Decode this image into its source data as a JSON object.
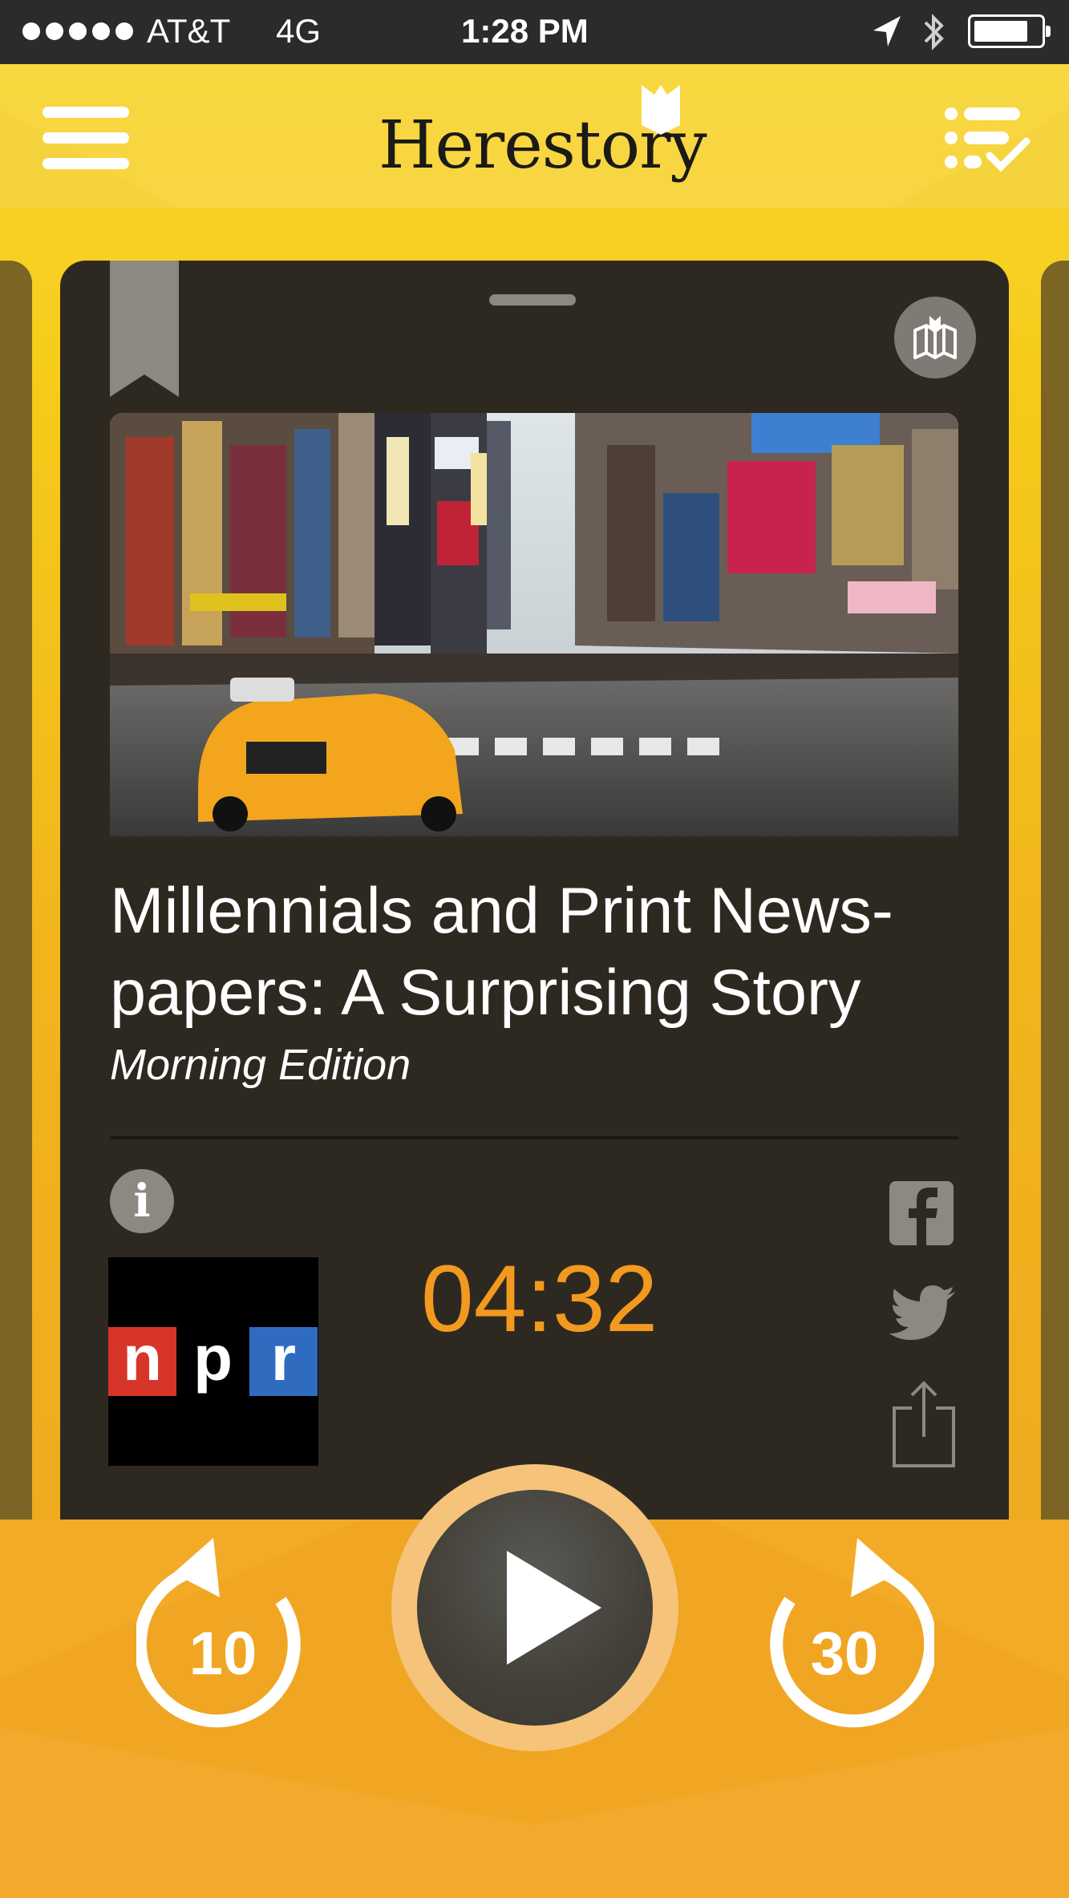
{
  "status_bar": {
    "carrier": "AT&T",
    "network": "4G",
    "time": "1:28 PM"
  },
  "header": {
    "title": "Herestory"
  },
  "story": {
    "title": "Millennials and Print News-papers: A Surprising Story",
    "title_line1": "Millennials and Print News-",
    "title_line2": "papers: A Surprising Story",
    "program": "Morning Edition",
    "duration": "04:32",
    "source_logo": {
      "n": "n",
      "p": "p",
      "r": "r"
    }
  },
  "controls": {
    "rewind_seconds": "10",
    "forward_seconds": "30"
  },
  "colors": {
    "accent": "#f29a1f",
    "header_yellow": "#f7d83e",
    "card_bg": "#2e2920",
    "controls_bg": "#f0a623"
  },
  "icons": [
    "menu-icon",
    "bookmark-icon",
    "playlist-check-icon",
    "map-icon",
    "info-icon",
    "facebook-icon",
    "twitter-icon",
    "share-icon",
    "rewind-icon",
    "play-icon",
    "forward-icon"
  ]
}
